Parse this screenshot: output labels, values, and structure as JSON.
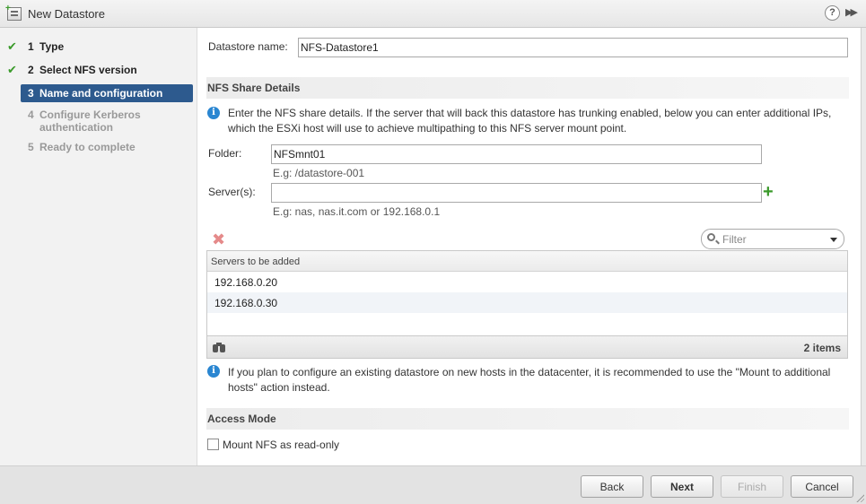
{
  "window": {
    "title": "New Datastore"
  },
  "steps": [
    {
      "num": "1",
      "label": "Type",
      "state": "done"
    },
    {
      "num": "2",
      "label": "Select NFS version",
      "state": "done"
    },
    {
      "num": "3",
      "label": "Name and configuration",
      "state": "active"
    },
    {
      "num": "4",
      "label": "Configure Kerberos authentication",
      "state": "pending"
    },
    {
      "num": "5",
      "label": "Ready to complete",
      "state": "pending"
    }
  ],
  "form": {
    "datastore_name_label": "Datastore name:",
    "datastore_name_value": "NFS-Datastore1",
    "nfs_section_title": "NFS Share Details",
    "nfs_info": "Enter the NFS share details. If the server that will back this datastore has trunking enabled, below you can enter additional IPs, which the ESXi host will use to achieve multipathing to this NFS server mount point.",
    "folder_label": "Folder:",
    "folder_value": "NFSmnt01",
    "folder_hint": "E.g: /datastore-001",
    "servers_label": "Server(s):",
    "servers_value": "",
    "servers_hint": "E.g: nas, nas.it.com or 192.168.0.1",
    "filter_placeholder": "Filter",
    "grid_header": "Servers to be added",
    "servers": [
      "192.168.0.20",
      "192.168.0.30"
    ],
    "item_count": "2 items",
    "mount_info": "If you plan to configure an existing datastore on new hosts in the datacenter, it is recommended to use the \"Mount to additional hosts\" action instead.",
    "access_section_title": "Access Mode",
    "readonly_label": "Mount NFS as read-only",
    "readonly_checked": false
  },
  "buttons": {
    "back": "Back",
    "next": "Next",
    "finish": "Finish",
    "cancel": "Cancel"
  },
  "icons": {
    "title": "new-datastore-icon",
    "help": "help-icon",
    "collapse": "double-chevron-right-icon",
    "check": "checkmark-icon",
    "info": "info-icon",
    "add": "add-server-icon",
    "remove": "remove-server-icon",
    "search": "search-icon",
    "binoculars": "binoculars-icon"
  },
  "colors": {
    "active_step": "#2d5a8e",
    "check_green": "#3a9a2a",
    "info_blue": "#2a86d1",
    "remove_red": "#e58a8a"
  }
}
